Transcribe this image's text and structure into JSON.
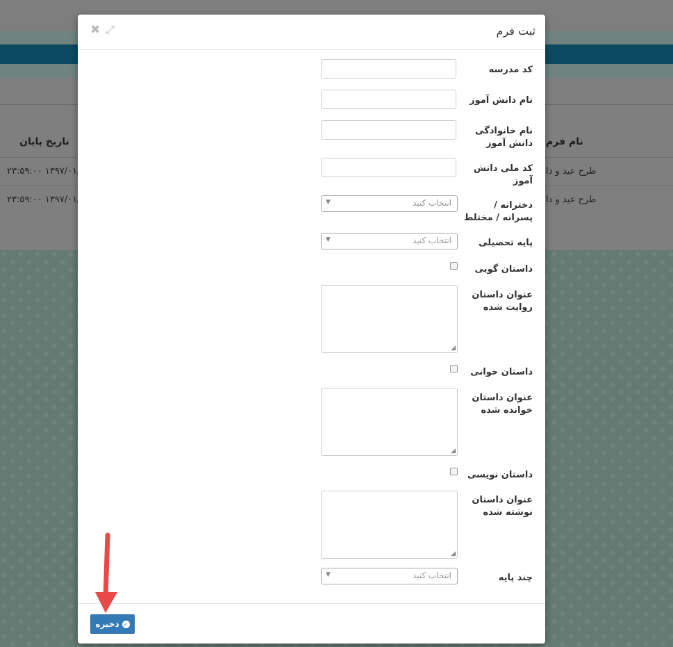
{
  "background": {
    "table": {
      "headers": {
        "end_date": "تاریخ پایان",
        "form_name": "نام فرم"
      },
      "rows": [
        {
          "end_date": "۲۳:۵۹:۰۰ ۱۳۹۷/۰۱/۲",
          "form_name": "طرح عید و دا"
        },
        {
          "end_date": "۲۳:۵۹:۰۰ ۱۳۹۷/۰۱/۲",
          "form_name": "طرح عید و دا"
        }
      ]
    }
  },
  "modal": {
    "title": "ثبت فرم",
    "icons": {
      "close": "close-icon",
      "expand": "expand-icon"
    },
    "fields": {
      "school_code": {
        "label": "کد مدرسه",
        "value": ""
      },
      "student_name": {
        "label": "نام دانش آموز",
        "value": ""
      },
      "student_family": {
        "label": "نام خانوادگی دانش آموز",
        "value": ""
      },
      "national_code": {
        "label": "کد ملی دانش آموز",
        "value": ""
      },
      "gender": {
        "label": "دخترانه / پسرانه / مختلط",
        "placeholder": "انتخاب کنید"
      },
      "grade": {
        "label": "پایه تحصیلی",
        "placeholder": "انتخاب کنید"
      },
      "storytelling": {
        "label": "داستان گویی",
        "checked": false
      },
      "told_story_title": {
        "label": "عنوان داستان روایت شده",
        "value": ""
      },
      "story_reading": {
        "label": "داستان خوانی",
        "checked": false
      },
      "read_story_title": {
        "label": "عنوان داستان خوانده شده",
        "value": ""
      },
      "story_writing": {
        "label": "داستان نویسی",
        "checked": false
      },
      "written_story_title": {
        "label": "عنوان داستان نوشته شده",
        "value": ""
      },
      "multi_grade": {
        "label": "چند پایه",
        "placeholder": "انتخاب کنید"
      }
    },
    "footer": {
      "save_label": "ذخیره",
      "save_icon": "check-circle-icon"
    }
  },
  "colors": {
    "primary": "#337ab7",
    "annotation_arrow": "#e84a48",
    "navbar": "#0b4a60"
  }
}
